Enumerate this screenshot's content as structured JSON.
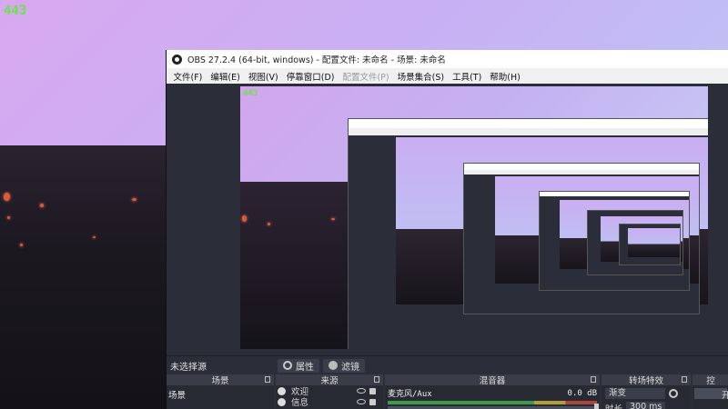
{
  "fps_counter": "443",
  "window": {
    "title": "OBS 27.2.4 (64-bit, windows) - 配置文件: 未命名 - 场景: 未命名"
  },
  "menubar": {
    "items": [
      {
        "label": "文件(F)",
        "enabled": true
      },
      {
        "label": "编辑(E)",
        "enabled": true
      },
      {
        "label": "视图(V)",
        "enabled": true
      },
      {
        "label": "停靠窗口(D)",
        "enabled": true
      },
      {
        "label": "配置文件(P)",
        "enabled": false
      },
      {
        "label": "场景集合(S)",
        "enabled": true
      },
      {
        "label": "工具(T)",
        "enabled": true
      },
      {
        "label": "帮助(H)",
        "enabled": true
      }
    ]
  },
  "preview": {
    "fps_counter": "443"
  },
  "source_toolbar": {
    "no_selection": "未选择源",
    "properties_label": "属性",
    "filters_label": "滤镜"
  },
  "docks": {
    "scenes": {
      "header": "场景",
      "items": [
        "场景"
      ]
    },
    "sources": {
      "header": "来源",
      "items": [
        {
          "name": "欢迎",
          "icon": "globe-icon"
        },
        {
          "name": "信息",
          "icon": "globe-icon"
        }
      ]
    },
    "mixer": {
      "header": "混音器",
      "channel_name": "麦克风/Aux",
      "level": "0.0 dB"
    },
    "transitions": {
      "header": "转场特效",
      "selected": "渐变",
      "duration_label": "时长",
      "duration_value": "300 ms"
    },
    "controls": {
      "header": "控",
      "button_label": "开"
    }
  },
  "colors": {
    "fps_green": "#6be34a",
    "obs_panel": "#2b2e38",
    "dock_header": "#3a3d48"
  }
}
